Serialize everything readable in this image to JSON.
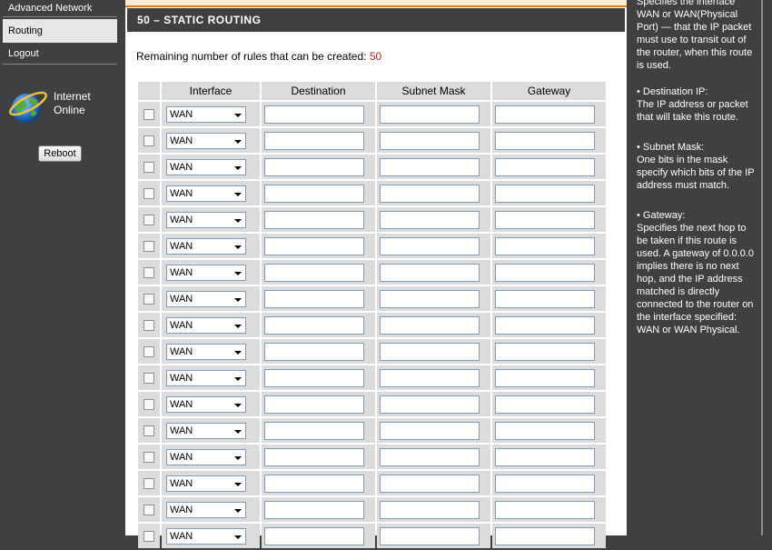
{
  "nav": {
    "advanced_network": "Advanced Network",
    "routing": "Routing",
    "logout": "Logout"
  },
  "status": {
    "line1": "Internet",
    "line2": "Online",
    "icon": "globe-icon"
  },
  "reboot_label": "Reboot",
  "section": {
    "title": "50 – STATIC ROUTING",
    "remaining_label": "Remaining number of rules that can be created: ",
    "remaining_count": "50"
  },
  "table": {
    "headers": [
      "Interface",
      "Destination",
      "Subnet Mask",
      "Gateway"
    ],
    "rows": [
      {
        "interface": "WAN",
        "destination": "",
        "subnet_mask": "",
        "gateway": "",
        "checked": false
      },
      {
        "interface": "WAN",
        "destination": "",
        "subnet_mask": "",
        "gateway": "",
        "checked": false
      },
      {
        "interface": "WAN",
        "destination": "",
        "subnet_mask": "",
        "gateway": "",
        "checked": false
      },
      {
        "interface": "WAN",
        "destination": "",
        "subnet_mask": "",
        "gateway": "",
        "checked": false
      },
      {
        "interface": "WAN",
        "destination": "",
        "subnet_mask": "",
        "gateway": "",
        "checked": false
      },
      {
        "interface": "WAN",
        "destination": "",
        "subnet_mask": "",
        "gateway": "",
        "checked": false
      },
      {
        "interface": "WAN",
        "destination": "",
        "subnet_mask": "",
        "gateway": "",
        "checked": false
      },
      {
        "interface": "WAN",
        "destination": "",
        "subnet_mask": "",
        "gateway": "",
        "checked": false
      },
      {
        "interface": "WAN",
        "destination": "",
        "subnet_mask": "",
        "gateway": "",
        "checked": false
      },
      {
        "interface": "WAN",
        "destination": "",
        "subnet_mask": "",
        "gateway": "",
        "checked": false
      },
      {
        "interface": "WAN",
        "destination": "",
        "subnet_mask": "",
        "gateway": "",
        "checked": false
      },
      {
        "interface": "WAN",
        "destination": "",
        "subnet_mask": "",
        "gateway": "",
        "checked": false
      },
      {
        "interface": "WAN",
        "destination": "",
        "subnet_mask": "",
        "gateway": "",
        "checked": false
      },
      {
        "interface": "WAN",
        "destination": "",
        "subnet_mask": "",
        "gateway": "",
        "checked": false
      },
      {
        "interface": "WAN",
        "destination": "",
        "subnet_mask": "",
        "gateway": "",
        "checked": false
      },
      {
        "interface": "WAN",
        "destination": "",
        "subnet_mask": "",
        "gateway": "",
        "checked": false
      },
      {
        "interface": "WAN",
        "destination": "",
        "subnet_mask": "",
        "gateway": "",
        "checked": false
      }
    ]
  },
  "help": {
    "intro": [
      "Specifies the interface",
      "WAN or WAN(Physical",
      "Port) — that the IP packet",
      "must use to transit out of",
      "the router, when this route",
      "is used."
    ],
    "dest_title": "• Destination IP:",
    "dest_text": [
      "The IP address or packet",
      "that will take this route."
    ],
    "mask_title": " • Subnet Mask:",
    "mask_text": [
      "One bits in the mask",
      "specify which bits of the IP",
      "address must match."
    ],
    "gw_title": " • Gateway:",
    "gw_text": [
      "Specifies the next hop to",
      "be taken if this route is",
      "used. A gateway of 0.0.0.0",
      "implies there is no next",
      "hop, and the IP address",
      "matched is directly",
      "connected to the router on",
      "the interface specified:",
      "WAN or WAN Physical."
    ]
  },
  "colors": {
    "sidebar_bg": "#3f4042",
    "selected_nav_bg": "#e6e6e6",
    "accent_orange": "#d97a24",
    "count_red": "#b22424"
  }
}
